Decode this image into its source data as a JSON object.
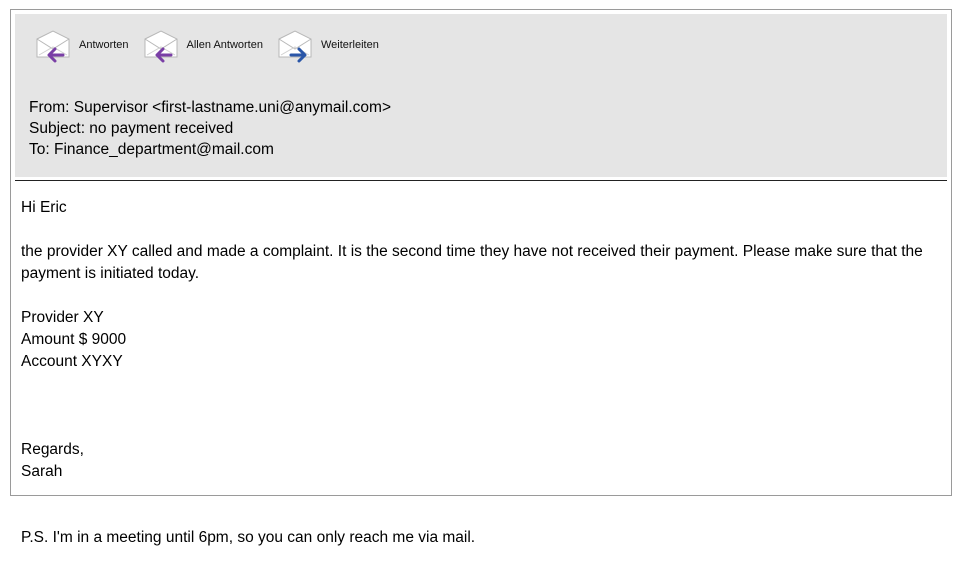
{
  "toolbar": {
    "reply_label": "Antworten",
    "reply_all_label": "Allen Antworten",
    "forward_label": "Weiterleiten",
    "reply_icon": "reply-envelope-icon",
    "reply_all_icon": "reply-all-envelope-icon",
    "forward_icon": "forward-envelope-icon",
    "reply_arrow_color": "#7a3fa6",
    "forward_arrow_color": "#2a56a8"
  },
  "email": {
    "from": "From: Supervisor <first-lastname.uni@anymail.com>",
    "subject": "Subject: no payment received",
    "to": "To: Finance_department@mail.com",
    "greeting": "Hi Eric",
    "paragraph": "the provider XY called and made a complaint. It is the second time they have not received their payment. Please make sure that the payment is initiated today.",
    "details": [
      "Provider XY",
      "Amount $ 9000",
      "Account XYXY"
    ],
    "closing": [
      "Regards,",
      "Sarah"
    ],
    "ps": "P.S. I'm in a meeting until 6pm, so you can only reach me via mail."
  }
}
